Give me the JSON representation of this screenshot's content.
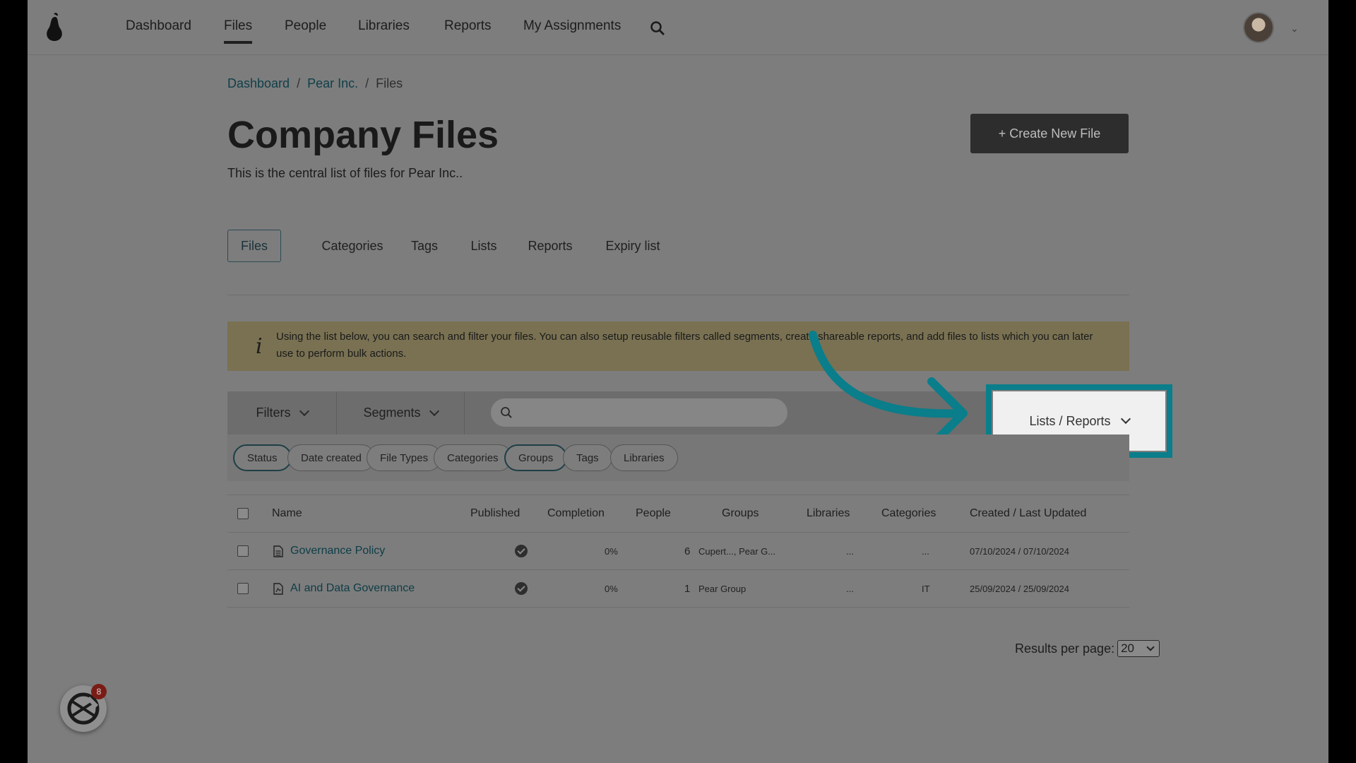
{
  "nav": {
    "items": [
      {
        "id": "dashboard",
        "label": "Dashboard"
      },
      {
        "id": "files",
        "label": "Files"
      },
      {
        "id": "people",
        "label": "People"
      },
      {
        "id": "libraries",
        "label": "Libraries"
      },
      {
        "id": "reports",
        "label": "Reports"
      },
      {
        "id": "my-assignments",
        "label": "My Assignments"
      }
    ],
    "active": "Files"
  },
  "breadcrumb": [
    "Dashboard",
    "Pear Inc.",
    "Files"
  ],
  "page": {
    "title": "Company Files",
    "subtitle": "This is the central list of files for Pear Inc..",
    "create_button": "+ Create New File"
  },
  "tabs": [
    "Files",
    "Categories",
    "Tags",
    "Lists",
    "Reports",
    "Expiry list"
  ],
  "info_banner": {
    "icon": "info-icon",
    "text": "Using the list below, you can search and filter your files. You can also setup reusable filters called segments, create shareable reports, and add files to lists which you can later use to perform bulk actions."
  },
  "filterbar": {
    "filters_label": "Filters",
    "segments_label": "Segments",
    "search_placeholder": "",
    "lists_reports_label": "Lists / Reports"
  },
  "chips": [
    "Status",
    "Date created",
    "File Types",
    "Categories",
    "Groups",
    "Tags",
    "Libraries"
  ],
  "active_chips": [
    "Status",
    "Groups"
  ],
  "table": {
    "headers": [
      "Name",
      "Published",
      "Completion",
      "People",
      "Groups",
      "Libraries",
      "Categories",
      "Created / Last Updated"
    ],
    "rows": [
      {
        "name": "Governance Policy",
        "published": true,
        "completion": "0%",
        "people": "6",
        "groups": "Cupert..., Pear G...",
        "libraries": "...",
        "categories": "...",
        "dates": "07/10/2024 / 07/10/2024"
      },
      {
        "name": "AI and Data Governance",
        "published": true,
        "completion": "0%",
        "people": "1",
        "groups": "Pear Group",
        "libraries": "...",
        "categories": "IT",
        "dates": "25/09/2024 / 25/09/2024"
      }
    ]
  },
  "pagination": {
    "results_per_page_label": "Results per page:",
    "results_per_page_value": "20"
  },
  "widget": {
    "badge_count": "8"
  },
  "colors": {
    "highlight": "#0a7e8a",
    "link": "#0f3f49",
    "banner": "#797152",
    "badge": "#7a1c16"
  }
}
